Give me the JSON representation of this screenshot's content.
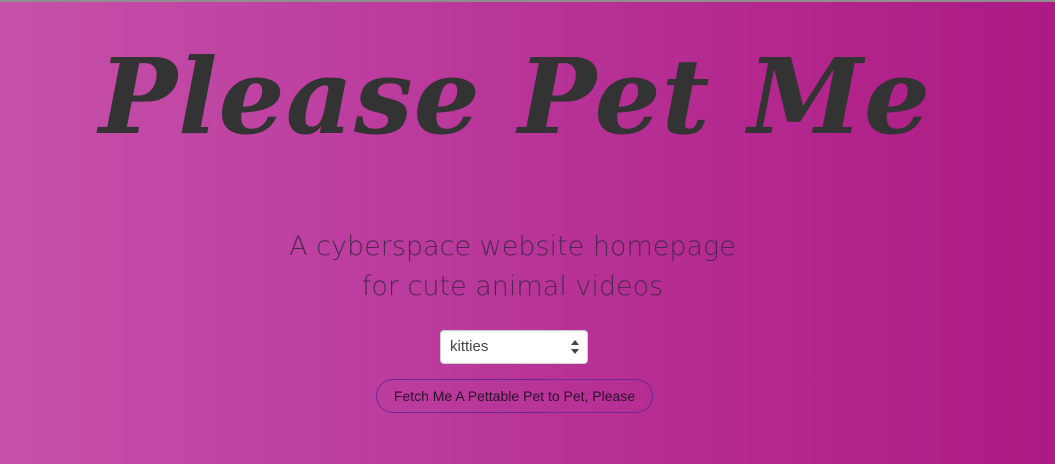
{
  "header": {
    "title": "Please Pet Me"
  },
  "hero": {
    "subtitle_line1": "A cyberspace website homepage",
    "subtitle_line2": "for cute animal videos"
  },
  "pet_select": {
    "selected": "kitties",
    "icon": "up-down-arrows-icon"
  },
  "fetch_button": {
    "label": "Fetch Me A Pettable Pet to Pet, Please"
  },
  "colors": {
    "background_left": "#c651a9",
    "background_right": "#ad1a85",
    "title_text": "#333333",
    "button_border": "#6a2a9a"
  }
}
